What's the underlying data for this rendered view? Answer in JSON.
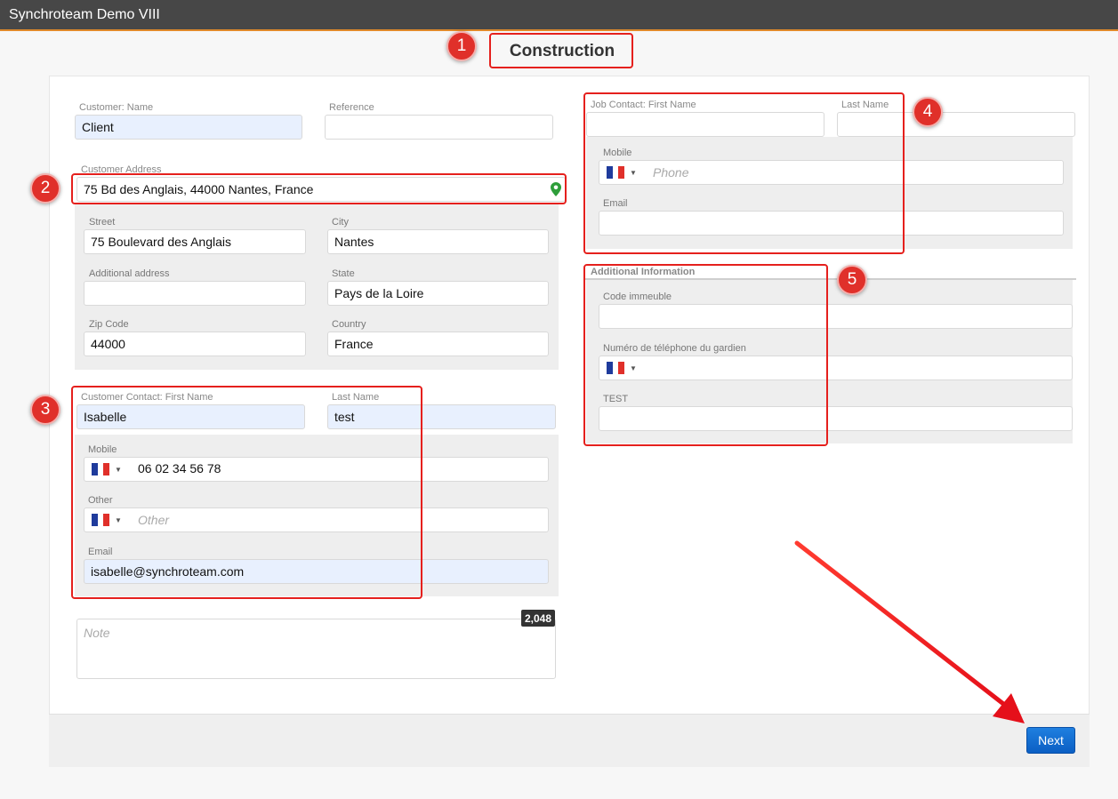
{
  "app": {
    "title": "Synchroteam Demo VIII"
  },
  "page": {
    "title": "Construction"
  },
  "customer": {
    "name_label": "Customer: Name",
    "name_value": "Client",
    "reference_label": "Reference",
    "reference_value": "",
    "address_label": "Customer Address",
    "address_value": "75 Bd des Anglais, 44000 Nantes, France",
    "address_icon": "map-pin-icon",
    "address_icon_color": "#2e9e3a",
    "street_label": "Street",
    "street_value": "75 Boulevard des Anglais",
    "city_label": "City",
    "city_value": "Nantes",
    "additional_label": "Additional address",
    "additional_value": "",
    "state_label": "State",
    "state_value": "Pays de la Loire",
    "zip_label": "Zip Code",
    "zip_value": "44000",
    "country_label": "Country",
    "country_value": "France"
  },
  "customer_contact": {
    "first_name_label": "Customer Contact: First Name",
    "first_name_value": "Isabelle",
    "last_name_label": "Last Name",
    "last_name_value": "test",
    "mobile_label": "Mobile",
    "mobile_value": "06 02 34 56 78",
    "other_label": "Other",
    "other_placeholder": "Other",
    "email_label": "Email",
    "email_value": "isabelle@synchroteam.com"
  },
  "note": {
    "placeholder": "Note",
    "counter": "2,048"
  },
  "job_contact": {
    "first_name_label": "Job Contact: First Name",
    "first_name_value": "",
    "last_name_label": "Last Name",
    "last_name_value": "",
    "mobile_label": "Mobile",
    "mobile_placeholder": "Phone",
    "email_label": "Email",
    "email_value": ""
  },
  "additional_info": {
    "heading": "Additional Information",
    "code_label": "Code immeuble",
    "code_value": "",
    "phone_label": "Numéro de téléphone du gardien",
    "test_label": "TEST",
    "test_value": ""
  },
  "flag": {
    "country": "France",
    "colors": [
      "#1f3b9c",
      "#ffffff",
      "#e0302a"
    ]
  },
  "annotations": {
    "badges": [
      "1",
      "2",
      "3",
      "4",
      "5"
    ],
    "color": "#e5201d"
  },
  "actions": {
    "next_label": "Next",
    "next_color": "#1f7fe0"
  }
}
